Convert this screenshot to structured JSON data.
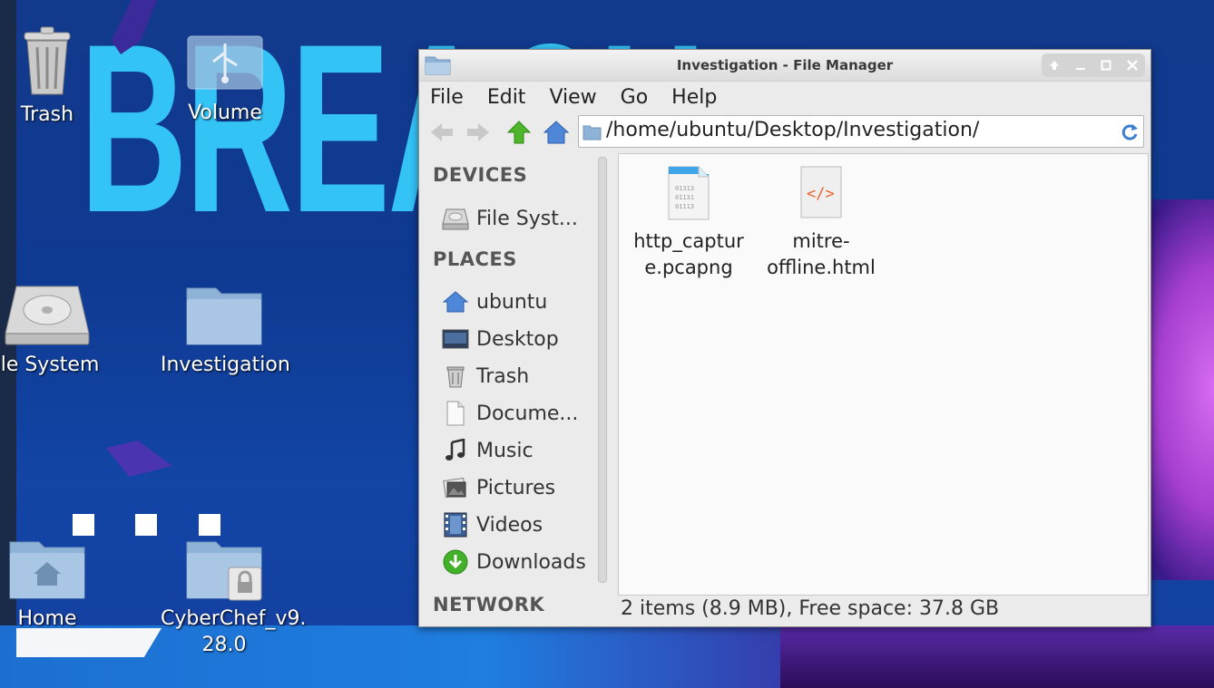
{
  "desktop": {
    "icons": [
      {
        "label": "Trash"
      },
      {
        "label": "Volume"
      },
      {
        "label": "ile System"
      },
      {
        "label": "Investigation"
      },
      {
        "label": "Home"
      },
      {
        "label": "CyberChef_v9.\n28.0"
      }
    ],
    "background_text": "BREACH"
  },
  "window": {
    "title": "Investigation - File Manager",
    "menu": [
      "File",
      "Edit",
      "View",
      "Go",
      "Help"
    ],
    "location_path": "/home/ubuntu/Desktop/Investigation/",
    "sidebar": {
      "devices_header": "DEVICES",
      "devices": [
        {
          "label": "File Syst...",
          "icon": "drive-icon"
        }
      ],
      "places_header": "PLACES",
      "places": [
        {
          "label": "ubuntu",
          "icon": "home-icon"
        },
        {
          "label": "Desktop",
          "icon": "desktop-icon"
        },
        {
          "label": "Trash",
          "icon": "trash-icon"
        },
        {
          "label": "Docume...",
          "icon": "document-icon"
        },
        {
          "label": "Music",
          "icon": "music-icon"
        },
        {
          "label": "Pictures",
          "icon": "pictures-icon"
        },
        {
          "label": "Videos",
          "icon": "videos-icon"
        },
        {
          "label": "Downloads",
          "icon": "downloads-icon"
        }
      ],
      "network_header": "NETWORK"
    },
    "files": [
      {
        "name": "http_captur\ne.pcapng",
        "icon": "binary-file-icon"
      },
      {
        "name": "mitre-\noffline.html",
        "icon": "html-file-icon"
      }
    ],
    "status": "2 items (8.9 MB), Free space: 37.8 GB"
  },
  "colors": {
    "desktop_bg": "#123a8c",
    "breach_text": "#33c3f5",
    "window_bg": "#ebebeb",
    "file_area_bg": "#fafafa"
  }
}
